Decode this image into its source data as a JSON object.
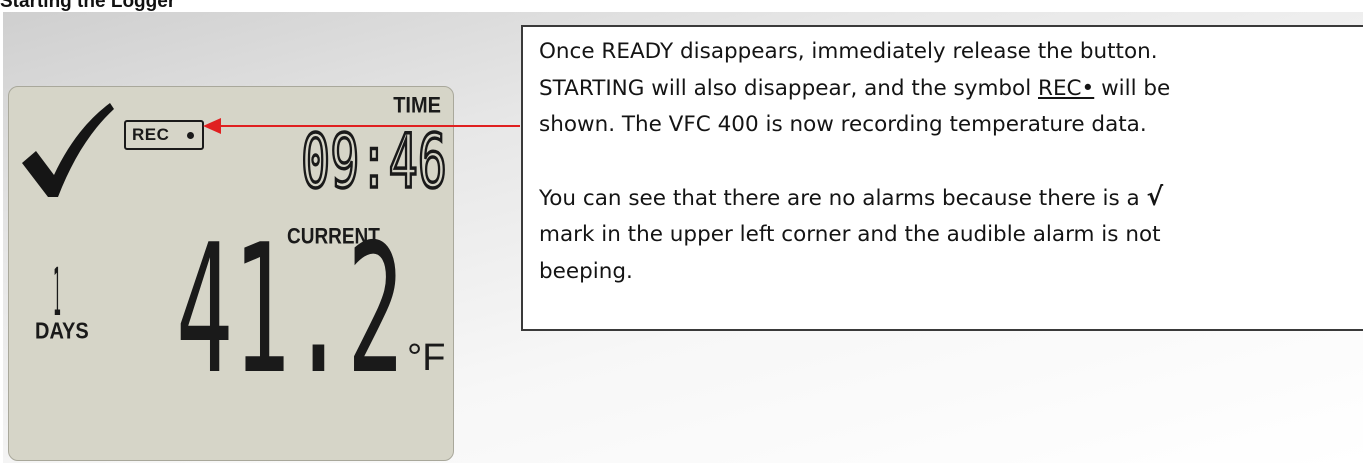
{
  "heading": "Starting the Logger",
  "display": {
    "rec_label": "REC",
    "time_label": "TIME",
    "time_value": "09:46",
    "current_label": "CURRENT",
    "days_value": "1",
    "days_label": "DAYS",
    "temperature_value": "41.2",
    "unit_label": "°F",
    "lcd_color": "#d6d5c8"
  },
  "callout": {
    "p1_before": "Once READY disappears, immediately release the button.",
    "p1_line2_before": "STARTING will also disappear, and the symbol ",
    "p1_symbol": "REC•",
    "p1_line2_after": " will be",
    "p1_line3": "shown. The VFC 400 is now recording temperature data.",
    "p2_line1_before": "You can see that there are no alarms because there is a ",
    "p2_check": "√",
    "p2_line2": "mark in the upper left corner and the audible alarm is not",
    "p2_line3": "beeping."
  },
  "colors": {
    "arrow": "#e02020"
  }
}
